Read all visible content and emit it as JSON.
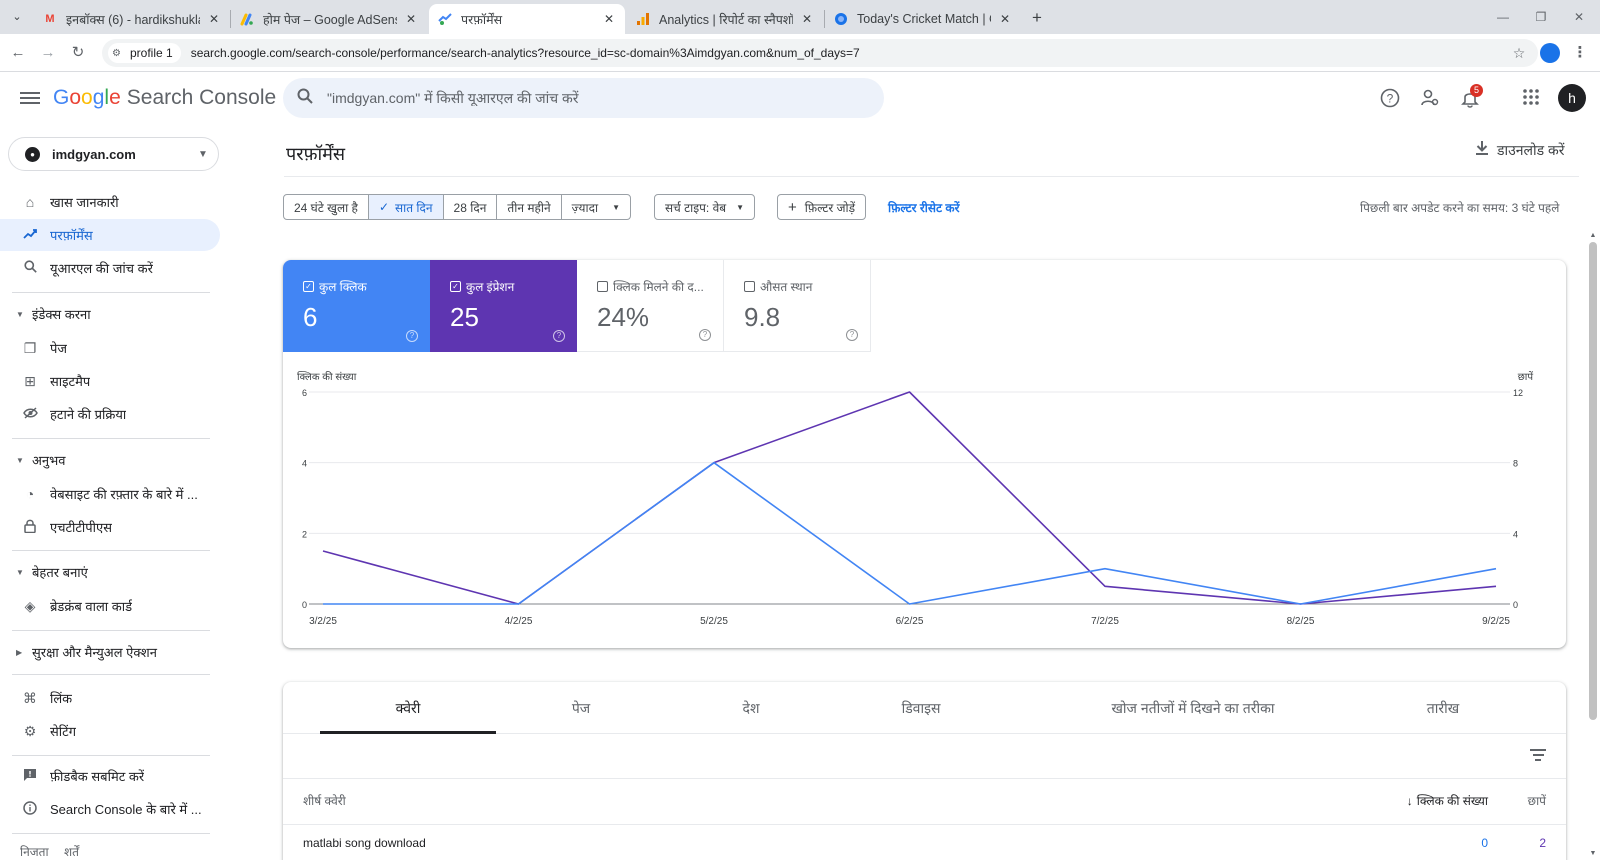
{
  "browser": {
    "tabs": [
      {
        "title": "इनबॉक्स (6) - hardikshukla",
        "favicon": "gmail-icon",
        "active": false
      },
      {
        "title": "होम पेज – Google AdSens",
        "favicon": "adsense-icon",
        "active": false
      },
      {
        "title": "परफ़ॉर्मेंस",
        "favicon": "search-console-icon",
        "active": true
      },
      {
        "title": "Analytics | रिपोर्ट का स्नैपशॉ",
        "favicon": "analytics-icon",
        "active": false
      },
      {
        "title": "Today's Cricket Match | C",
        "favicon": "globe-icon",
        "active": false
      }
    ],
    "profile_chip": "profile 1",
    "url": "search.google.com/search-console/performance/search-analytics?resource_id=sc-domain%3Aimdgyan.com&num_of_days=7"
  },
  "header": {
    "brand_google": "Google",
    "brand_product": "Search Console",
    "search_placeholder": "\"imdgyan.com\" में किसी यूआरएल की जांच करें",
    "notification_count": "5",
    "avatar_letter": "h"
  },
  "sidebar": {
    "property": "imdgyan.com",
    "items": [
      {
        "label": "खास जानकारी",
        "icon": "home-icon"
      },
      {
        "label": "परफ़ॉर्मेंस",
        "icon": "trending-up-icon"
      },
      {
        "label": "यूआरएल की जांच करें",
        "icon": "search-icon"
      }
    ],
    "sections": [
      {
        "label": "इंडेक्स करना",
        "expanded": true,
        "items": [
          {
            "label": "पेज",
            "icon": "pages-icon"
          },
          {
            "label": "साइटमैप",
            "icon": "sitemap-icon"
          },
          {
            "label": "हटाने की प्रक्रिया",
            "icon": "visibility-off-icon"
          }
        ]
      },
      {
        "label": "अनुभव",
        "expanded": true,
        "items": [
          {
            "label": "वेबसाइट की रफ़्तार के बारे में ...",
            "icon": "speed-icon"
          },
          {
            "label": "एचटीटीपीएस",
            "icon": "lock-icon"
          }
        ]
      },
      {
        "label": "बेहतर बनाएं",
        "expanded": true,
        "items": [
          {
            "label": "ब्रेडक्रंब वाला कार्ड",
            "icon": "layers-icon"
          }
        ]
      },
      {
        "label": "सुरक्षा और मैन्युअल ऐक्शन",
        "expanded": false,
        "items": []
      }
    ],
    "bottom_items": [
      {
        "label": "लिंक",
        "icon": "links-icon"
      },
      {
        "label": "सेटिंग",
        "icon": "gear-icon"
      }
    ],
    "support_items": [
      {
        "label": "फ़ीडबैक सबमिट करें",
        "icon": "feedback-icon"
      },
      {
        "label": "Search Console के बारे में ...",
        "icon": "info-icon"
      }
    ],
    "footer": [
      "निजता",
      "शर्तें"
    ]
  },
  "main": {
    "title": "परफ़ॉर्मेंस",
    "download_label": "डाउनलोड करें",
    "date_ranges": [
      "24 घंटे खुला है",
      "सात दिन",
      "28 दिन",
      "तीन महीने",
      "ज़्यादा"
    ],
    "selected_range": "सात दिन",
    "search_type_chip": "सर्च टाइप: वेब",
    "add_filter": "फ़िल्टर जोड़ें",
    "reset_filters": "फ़िल्टर रीसेट करें",
    "last_updated": "पिछली बार अपडेट करने का समय: 3 घंटे पहले",
    "metrics": [
      {
        "label": "कुल क्लिक",
        "value": "6",
        "selected": true
      },
      {
        "label": "कुल इंप्रेशन",
        "value": "25",
        "selected": true
      },
      {
        "label": "क्लिक मिलने की द...",
        "value": "24%",
        "selected": false
      },
      {
        "label": "औसत स्थान",
        "value": "9.8",
        "selected": false
      }
    ],
    "dimension_tabs": [
      "क्वेरी",
      "पेज",
      "देश",
      "डिवाइस",
      "खोज नतीजों में दिखने का तरीका",
      "तारीख"
    ],
    "active_tab": "क्वेरी",
    "table": {
      "headers": [
        "शीर्ष क्वेरी",
        "क्लिक की संख्या",
        "छापें"
      ],
      "sort_indicator": "↓",
      "rows": [
        {
          "query": "matlabi song download",
          "clicks": "0",
          "impressions": "2"
        }
      ]
    }
  },
  "chart_data": {
    "type": "line",
    "x": [
      "3/2/25",
      "4/2/25",
      "5/2/25",
      "6/2/25",
      "7/2/25",
      "8/2/25",
      "9/2/25"
    ],
    "series": [
      {
        "name": "क्लिक की संख्या",
        "axis": "left",
        "color": "#4285f4",
        "values": [
          0,
          0,
          4,
          0,
          1,
          0,
          1
        ]
      },
      {
        "name": "छापें",
        "axis": "right",
        "color": "#5e35b1",
        "values": [
          3,
          0,
          8,
          12,
          1,
          0,
          1
        ]
      }
    ],
    "ylabel_left": "क्लिक की संख्या",
    "ylabel_right": "छापें",
    "yticks_left": [
      "0",
      "2",
      "4",
      "6"
    ],
    "yticks_right": [
      "0",
      "4",
      "8",
      "12"
    ],
    "ylim_left": [
      0,
      6
    ],
    "ylim_right": [
      0,
      12
    ],
    "grid": true
  }
}
